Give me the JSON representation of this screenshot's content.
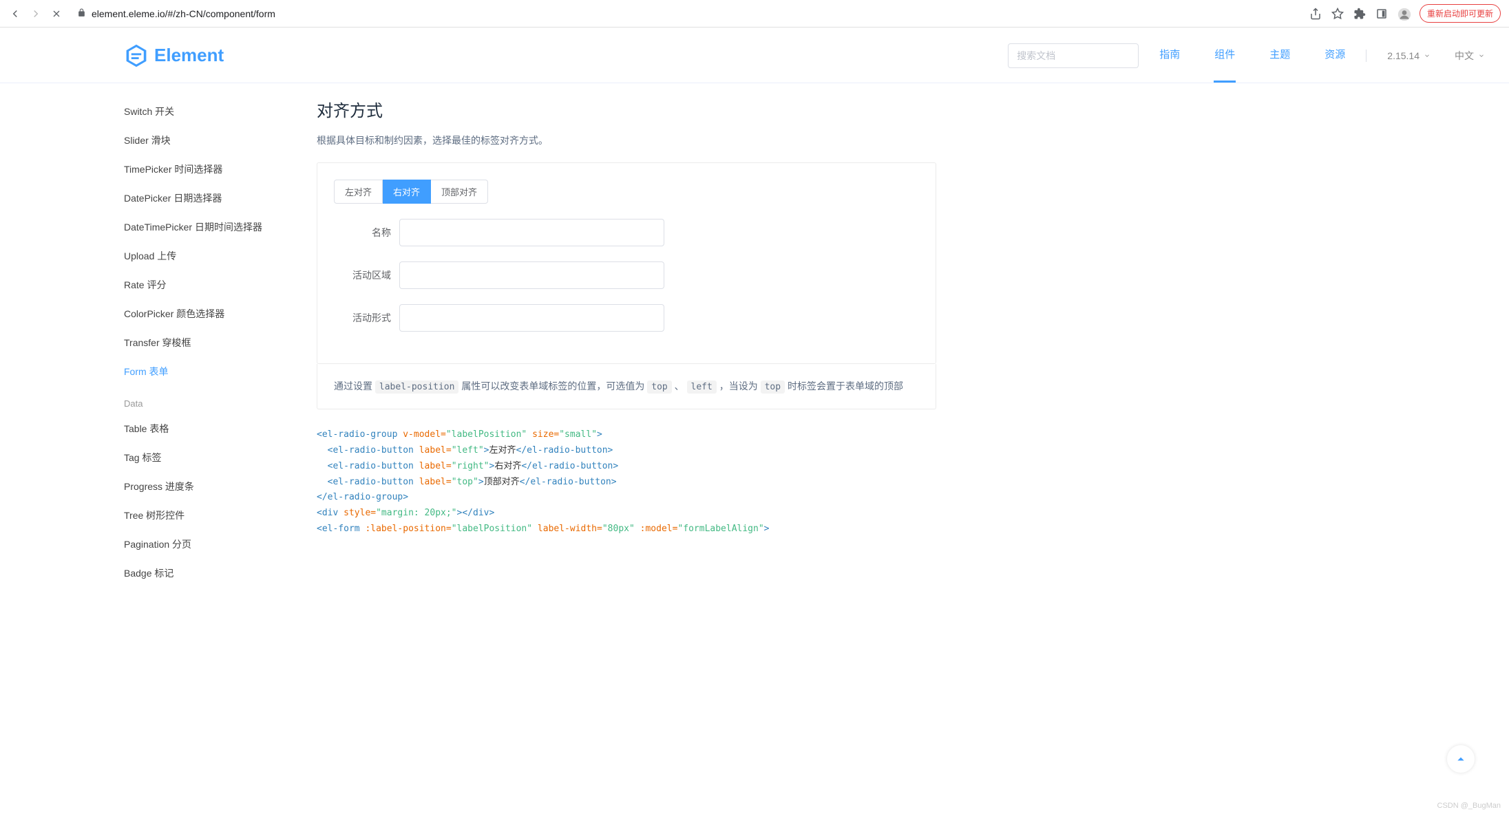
{
  "browser": {
    "url": "element.eleme.io/#/zh-CN/component/form",
    "update_label": "重新启动即可更新"
  },
  "header": {
    "logo_text": "Element",
    "search_placeholder": "搜索文档",
    "nav": {
      "guide": "指南",
      "component": "组件",
      "theme": "主题",
      "resource": "资源"
    },
    "version": "2.15.14",
    "language": "中文"
  },
  "sidebar": {
    "items": [
      {
        "label": "Switch 开关"
      },
      {
        "label": "Slider 滑块"
      },
      {
        "label": "TimePicker 时间选择器"
      },
      {
        "label": "DatePicker 日期选择器"
      },
      {
        "label": "DateTimePicker 日期时间选择器"
      },
      {
        "label": "Upload 上传"
      },
      {
        "label": "Rate 评分"
      },
      {
        "label": "ColorPicker 颜色选择器"
      },
      {
        "label": "Transfer 穿梭框"
      },
      {
        "label": "Form 表单",
        "active": true
      }
    ],
    "group_data": "Data",
    "data_items": [
      {
        "label": "Table 表格"
      },
      {
        "label": "Tag 标签"
      },
      {
        "label": "Progress 进度条"
      },
      {
        "label": "Tree 树形控件"
      },
      {
        "label": "Pagination 分页"
      },
      {
        "label": "Badge 标记"
      }
    ]
  },
  "main": {
    "title": "对齐方式",
    "desc": "根据具体目标和制约因素，选择最佳的标签对齐方式。",
    "radios": {
      "left": "左对齐",
      "right": "右对齐",
      "top": "顶部对齐"
    },
    "form": {
      "name_label": "名称",
      "region_label": "活动区域",
      "type_label": "活动形式"
    },
    "explain": {
      "part1": "通过设置 ",
      "code1": "label-position",
      "part2": " 属性可以改变表单域标签的位置，可选值为 ",
      "code2": "top",
      "sep": " 、 ",
      "code3": "left",
      "part3": " ，当设为 ",
      "code4": "top",
      "part4": " 时标签会置于表单域的顶部"
    },
    "code": {
      "l1_open": "<el-radio-group",
      "l1_attr1": " v-model=",
      "l1_val1": "\"labelPosition\"",
      "l1_attr2": " size=",
      "l1_val2": "\"small\"",
      "l1_close": ">",
      "l2_open": "<el-radio-button",
      "l2_attr": " label=",
      "l2_val": "\"left\"",
      "l2_mid": ">",
      "l2_text": "左对齐",
      "l2_close": "</el-radio-button>",
      "l3_val": "\"right\"",
      "l3_text": "右对齐",
      "l4_val": "\"top\"",
      "l4_text": "顶部对齐",
      "l5": "</el-radio-group>",
      "l6_open": "<div",
      "l6_attr": " style=",
      "l6_val": "\"margin: 20px;\"",
      "l6_mid": ">",
      "l6_close": "</div>",
      "l7_open": "<el-form",
      "l7_attr1": " :label-position=",
      "l7_val1": "\"labelPosition\"",
      "l7_attr2": " label-width=",
      "l7_val2": "\"80px\"",
      "l7_attr3": " :model=",
      "l7_val3": "\"formLabelAlign\"",
      "l7_close": ">"
    }
  },
  "watermark": "CSDN @_BugMan"
}
